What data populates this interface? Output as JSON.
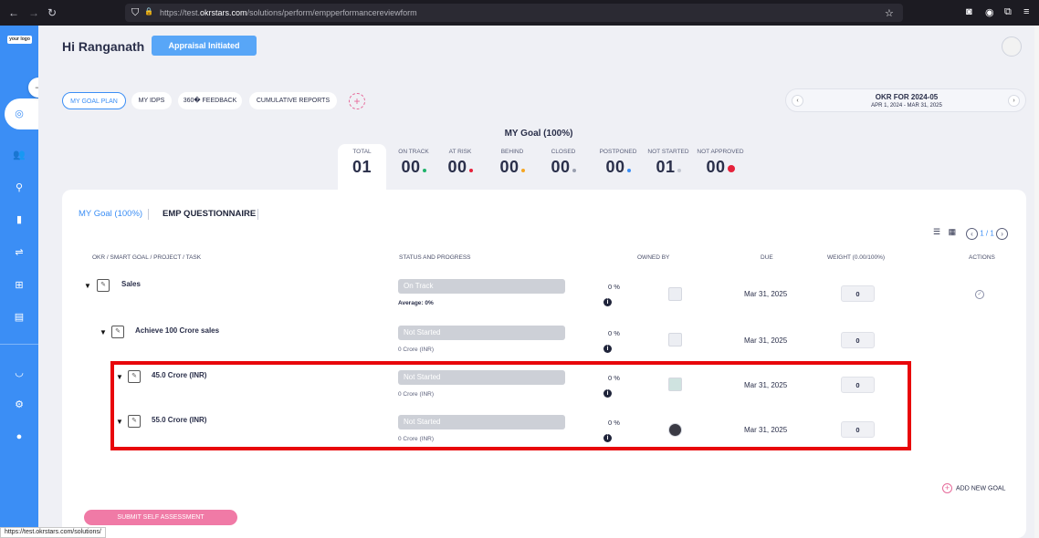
{
  "browser": {
    "url_prefix": "https://test.",
    "url_domain": "okrstars.com",
    "url_path": "/solutions/perform/empperformancereviewform",
    "status_url": "https://test.okrstars.com/solutions/"
  },
  "logo": "your logo",
  "header": {
    "greeting": "Hi Ranganath",
    "appraisal_button": "Appraisal Initiated"
  },
  "tabs": [
    {
      "label": "MY GOAL PLAN",
      "selected": true
    },
    {
      "label": "MY IDPS",
      "selected": false
    },
    {
      "label": "360� FEEDBACK",
      "selected": false
    },
    {
      "label": "CUMULATIVE REPORTS",
      "selected": false
    }
  ],
  "add_tab_symbol": "+",
  "okr_period": {
    "title": "OKR FOR 2024-05",
    "dates": "APR 1, 2024 - MAR 31, 2025",
    "prev": "‹",
    "next": "›"
  },
  "goal_title": "MY Goal (100%)",
  "stats": [
    {
      "label": "TOTAL",
      "value": "01",
      "dot": ""
    },
    {
      "label": "ON TRACK",
      "value": "00",
      "dot": "#1fb36b"
    },
    {
      "label": "AT RISK",
      "value": "00",
      "dot": "#e5223b"
    },
    {
      "label": "BEHIND",
      "value": "00",
      "dot": "#f5a623"
    },
    {
      "label": "CLOSED",
      "value": "00",
      "dot": "#9aa0b0"
    },
    {
      "label": "POSTPONED",
      "value": "00",
      "dot": "#3b8ef5"
    },
    {
      "label": "NOT STARTED",
      "value": "01",
      "dot": "#c3c7d2"
    },
    {
      "label": "NOT APPROVED",
      "value": "00",
      "dot": "#e5223b"
    }
  ],
  "subtabs": {
    "goal": "MY Goal (100%)",
    "questionnaire": "EMP QUESTIONNAIRE"
  },
  "pager": {
    "text": "1 / 1",
    "prev": "‹",
    "next": "›"
  },
  "table": {
    "headers": {
      "okr": "OKR / SMART GOAL / PROJECT / TASK",
      "status": "STATUS AND PROGRESS",
      "owned": "OWNED BY",
      "due": "DUE",
      "weight": "WEIGHT (0.00/100%)",
      "actions": "ACTIONS"
    },
    "rows": [
      {
        "name": "Sales",
        "status": "On Track",
        "sub": "Average: 0%",
        "pct": "0 %",
        "due": "Mar 31, 2025",
        "weight": "0"
      },
      {
        "name": "Achieve 100 Crore sales",
        "status": "Not Started",
        "sub": "0 Crore (INR)",
        "pct": "0 %",
        "due": "Mar 31, 2025",
        "weight": "0"
      },
      {
        "name": "45.0 Crore (INR)",
        "status": "Not Started",
        "sub": "0 Crore (INR)",
        "pct": "0 %",
        "due": "Mar 31, 2025",
        "weight": "0"
      },
      {
        "name": "55.0 Crore (INR)",
        "status": "Not Started",
        "sub": "0 Crore (INR)",
        "pct": "0 %",
        "due": "Mar 31, 2025",
        "weight": "0"
      }
    ]
  },
  "add_goal": "ADD NEW GOAL",
  "submit": "SUBMIT SELF ASSESSMENT",
  "icons": {
    "back": "←",
    "forward": "→",
    "reload": "↻",
    "shield": "⛉",
    "lock": "🔒",
    "star": "☆",
    "pocket": "◙",
    "account": "◉",
    "extensions": "⧉",
    "menu": "≡",
    "collapse": "⇥",
    "target": "◎",
    "team": "👥",
    "person": "⚲",
    "book": "▮",
    "handshake": "⇌",
    "tree": "⊞",
    "report": "▤",
    "eye": "◡",
    "gear": "⚙",
    "user": "●",
    "list": "☰",
    "grid": "▦",
    "caret": "▼",
    "task": "✎",
    "info": "i",
    "check": "✓"
  }
}
